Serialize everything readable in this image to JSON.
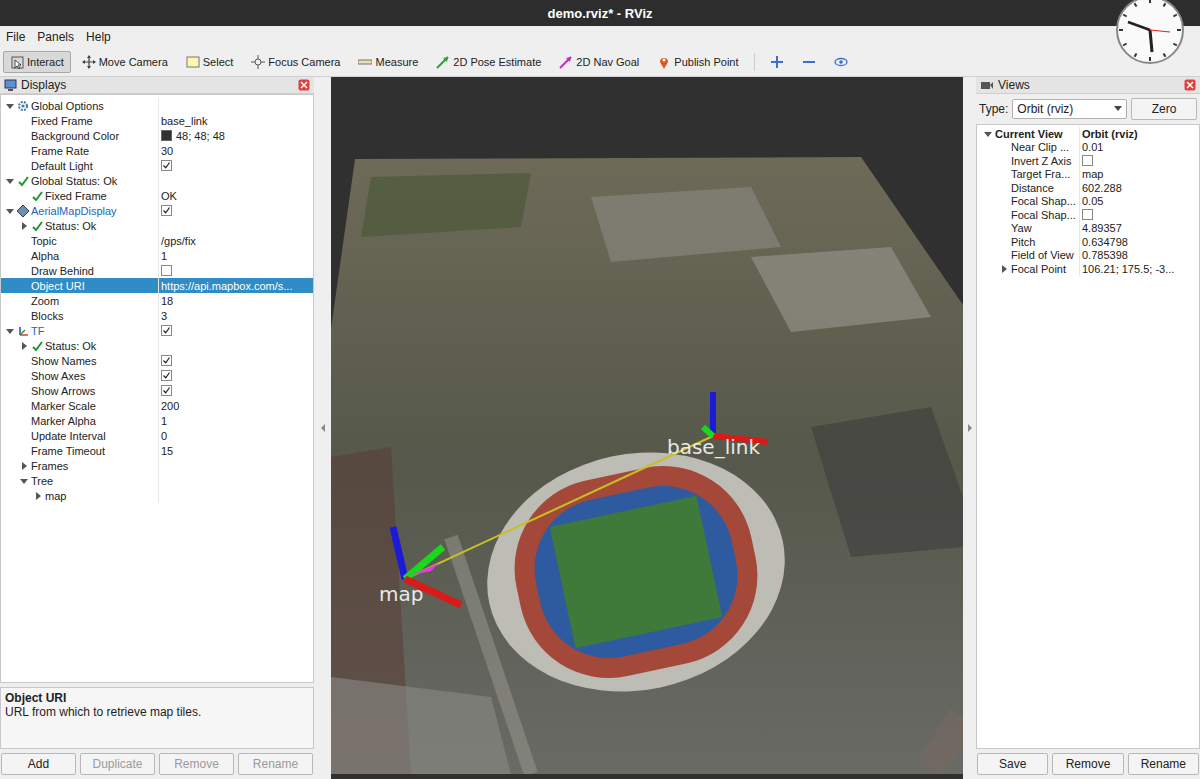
{
  "window": {
    "title": "demo.rviz* - RViz"
  },
  "menu": [
    "File",
    "Panels",
    "Help"
  ],
  "toolbar": [
    {
      "label": "Interact",
      "kind": "interact",
      "selected": true
    },
    {
      "label": "Move Camera",
      "kind": "camera",
      "selected": false
    },
    {
      "label": "Select",
      "kind": "select",
      "selected": false
    },
    {
      "label": "Focus Camera",
      "kind": "focus",
      "selected": false
    },
    {
      "label": "Measure",
      "kind": "measure",
      "selected": false
    },
    {
      "label": "2D Pose Estimate",
      "kind": "pose",
      "selected": false
    },
    {
      "label": "2D Nav Goal",
      "kind": "goal",
      "selected": false
    },
    {
      "label": "Publish Point",
      "kind": "point",
      "selected": false
    },
    {
      "label": "",
      "kind": "plus",
      "selected": false
    },
    {
      "label": "",
      "kind": "minus",
      "selected": false
    },
    {
      "label": "",
      "kind": "eye",
      "selected": false
    }
  ],
  "displays": {
    "title": "Displays",
    "rows": [
      {
        "label": "Global Options",
        "value": "",
        "indent": 0,
        "kind": "group",
        "expanded": true,
        "selected": false
      },
      {
        "label": "Fixed Frame",
        "value": "base_link",
        "indent": 1,
        "kind": "property",
        "selected": false
      },
      {
        "label": "Background Color",
        "value": "48; 48; 48",
        "indent": 1,
        "kind": "color",
        "color": "#303030",
        "selected": false
      },
      {
        "label": "Frame Rate",
        "value": "30",
        "indent": 1,
        "kind": "property",
        "selected": false
      },
      {
        "label": "Default Light",
        "indent": 1,
        "kind": "check",
        "checked": true,
        "selected": false
      },
      {
        "label": "Global Status: Ok",
        "value": "",
        "indent": 0,
        "kind": "status",
        "ok": true,
        "expanded": true,
        "selected": false
      },
      {
        "label": "Fixed Frame",
        "value": "OK",
        "indent": 1,
        "kind": "status",
        "ok": true,
        "selected": false
      },
      {
        "label": "AerialMapDisplay",
        "indent": 0,
        "kind": "mapdisplay",
        "checked": true,
        "expanded": true,
        "selected": false
      },
      {
        "label": "Status: Ok",
        "value": "",
        "indent": 1,
        "kind": "status",
        "ok": true,
        "expanded": false,
        "selected": false
      },
      {
        "label": "Topic",
        "value": "/gps/fix",
        "indent": 1,
        "kind": "property",
        "selected": false
      },
      {
        "label": "Alpha",
        "value": "1",
        "indent": 1,
        "kind": "property",
        "selected": false
      },
      {
        "label": "Draw Behind",
        "indent": 1,
        "kind": "check",
        "checked": false,
        "selected": false
      },
      {
        "label": "Object URI",
        "value": "https://api.mapbox.com/s...",
        "indent": 1,
        "kind": "property",
        "selected": true
      },
      {
        "label": "Zoom",
        "value": "18",
        "indent": 1,
        "kind": "property",
        "selected": false
      },
      {
        "label": "Blocks",
        "value": "3",
        "indent": 1,
        "kind": "property",
        "selected": false
      },
      {
        "label": "TF",
        "indent": 0,
        "kind": "tfdisplay",
        "checked": true,
        "expanded": true,
        "selected": false
      },
      {
        "label": "Status: Ok",
        "value": "",
        "indent": 1,
        "kind": "status",
        "ok": true,
        "expanded": false,
        "selected": false
      },
      {
        "label": "Show Names",
        "indent": 1,
        "kind": "check",
        "checked": true,
        "selected": false
      },
      {
        "label": "Show Axes",
        "indent": 1,
        "kind": "check",
        "checked": true,
        "selected": false
      },
      {
        "label": "Show Arrows",
        "indent": 1,
        "kind": "check",
        "checked": true,
        "selected": false
      },
      {
        "label": "Marker Scale",
        "value": "200",
        "indent": 1,
        "kind": "property",
        "selected": false
      },
      {
        "label": "Marker Alpha",
        "value": "1",
        "indent": 1,
        "kind": "property",
        "selected": false
      },
      {
        "label": "Update Interval",
        "value": "0",
        "indent": 1,
        "kind": "property",
        "selected": false
      },
      {
        "label": "Frame Timeout",
        "value": "15",
        "indent": 1,
        "kind": "property",
        "selected": false
      },
      {
        "label": "Frames",
        "value": "",
        "indent": 1,
        "kind": "property",
        "expanded": false,
        "selected": false
      },
      {
        "label": "Tree",
        "value": "",
        "indent": 1,
        "kind": "property",
        "expanded": true,
        "selected": false
      },
      {
        "label": "map",
        "value": "",
        "indent": 2,
        "kind": "property",
        "expanded": false,
        "selected": false
      }
    ],
    "description": {
      "title": "Object URI",
      "text": "URL from which to retrieve map tiles."
    },
    "buttons": [
      {
        "label": "Add",
        "disabled": false
      },
      {
        "label": "Duplicate",
        "disabled": true
      },
      {
        "label": "Remove",
        "disabled": true
      },
      {
        "label": "Rename",
        "disabled": true
      }
    ]
  },
  "scene": {
    "tf_frames": [
      {
        "name": "base_link"
      },
      {
        "name": "map"
      }
    ]
  },
  "views": {
    "title": "Views",
    "type_label": "Type:",
    "type_value": "Orbit (rviz)",
    "zero_button": "Zero",
    "rows": [
      {
        "label": "Current View",
        "value": "Orbit (rviz)",
        "kind": "header",
        "expanded": true,
        "selected": false
      },
      {
        "label": "Near Clip ...",
        "value": "0.01",
        "kind": "property",
        "selected": false
      },
      {
        "label": "Invert Z Axis",
        "kind": "check",
        "checked": false,
        "selected": false
      },
      {
        "label": "Target Fra...",
        "value": "map",
        "kind": "property",
        "selected": false
      },
      {
        "label": "Distance",
        "value": "602.288",
        "kind": "property",
        "selected": false
      },
      {
        "label": "Focal Shap...",
        "value": "0.05",
        "kind": "property",
        "selected": false
      },
      {
        "label": "Focal Shap...",
        "kind": "check",
        "checked": false,
        "selected": false
      },
      {
        "label": "Yaw",
        "value": "4.89357",
        "kind": "property",
        "selected": false
      },
      {
        "label": "Pitch",
        "value": "0.634798",
        "kind": "property",
        "selected": false
      },
      {
        "label": "Field of View",
        "value": "0.785398",
        "kind": "property",
        "selected": false
      },
      {
        "label": "Focal Point",
        "value": "106.21; 175.5; -3...",
        "kind": "property",
        "expanded": false,
        "selected": false
      }
    ],
    "buttons": [
      "Save",
      "Remove",
      "Rename"
    ]
  }
}
